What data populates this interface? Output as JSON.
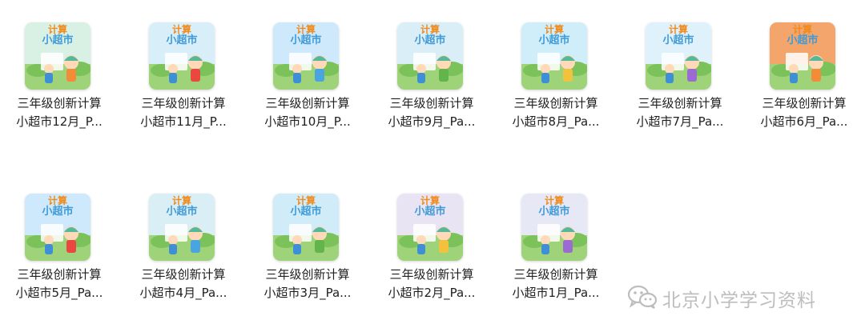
{
  "files": [
    {
      "line1": "三年级创新计算",
      "line2": "小超市12月_P...",
      "bg": "#d9f0e4"
    },
    {
      "line1": "三年级创新计算",
      "line2": "小超市11月_P...",
      "bg": "#d8eef8"
    },
    {
      "line1": "三年级创新计算",
      "line2": "小超市10月_P...",
      "bg": "#cde9fb"
    },
    {
      "line1": "三年级创新计算",
      "line2": "小超市9月_Pa...",
      "bg": "#d9eef7"
    },
    {
      "line1": "三年级创新计算",
      "line2": "小超市8月_Pa...",
      "bg": "#cfeefa"
    },
    {
      "line1": "三年级创新计算",
      "line2": "小超市7月_Pa...",
      "bg": "#dff2fb"
    },
    {
      "line1": "三年级创新计算",
      "line2": "小超市6月_Pa...",
      "bg": "#f3a56b"
    },
    {
      "line1": "三年级创新计算",
      "line2": "小超市5月_Pa...",
      "bg": "#cde9fb"
    },
    {
      "line1": "三年级创新计算",
      "line2": "小超市4月_Pa...",
      "bg": "#d9eef5"
    },
    {
      "line1": "三年级创新计算",
      "line2": "小超市3月_Pa...",
      "bg": "#d0ecf9"
    },
    {
      "line1": "三年级创新计算",
      "line2": "小超市2月_Pa...",
      "bg": "#e9e4f4"
    },
    {
      "line1": "三年级创新计算",
      "line2": "小超市1月_Pa...",
      "bg": "#e6e8f6"
    }
  ],
  "thumb_title": {
    "top": "计算",
    "bottom": "小超市"
  },
  "watermark": {
    "text": "北京小学学习资料",
    "icon": "wechat-icon",
    "color": "#bdbdbd"
  }
}
